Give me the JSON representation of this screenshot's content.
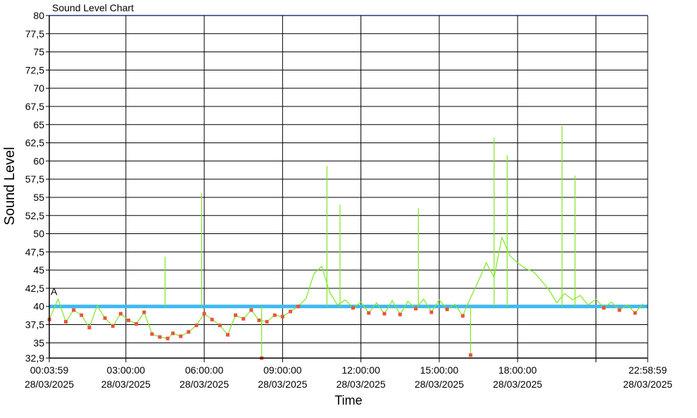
{
  "chart_data": {
    "type": "line",
    "title": "Sound Level Chart",
    "xlabel": "Time",
    "ylabel": "Sound Level",
    "ylim": [
      32.9,
      80
    ],
    "y_ticks": [
      "32,9",
      "35",
      "37,5",
      "40",
      "42,5",
      "45",
      "47,5",
      "50",
      "52,5",
      "55",
      "57,5",
      "60",
      "62,5",
      "65",
      "67,5",
      "70",
      "72,5",
      "75",
      "77,5",
      "80"
    ],
    "x_range_hours": [
      0.0664,
      22.9831
    ],
    "x_ticks": [
      {
        "time": "00:03:59",
        "date": "28/03/2025"
      },
      {
        "time": "03:00:00",
        "date": "28/03/2025"
      },
      {
        "time": "06:00:00",
        "date": "28/03/2025"
      },
      {
        "time": "09:00:00",
        "date": "28/03/2025"
      },
      {
        "time": "12:00:00",
        "date": "28/03/2025"
      },
      {
        "time": "15:00:00",
        "date": "28/03/2025"
      },
      {
        "time": "18:00:00",
        "date": "28/03/2025"
      },
      {
        "time": "",
        "date": ""
      },
      {
        "time": "22:58:59",
        "date": "28/03/2025"
      }
    ],
    "x_tick_hours": [
      0.0664,
      3,
      6,
      9,
      12,
      15,
      18,
      21,
      22.9831
    ],
    "grid": true,
    "threshold": {
      "label": "A",
      "value": 40,
      "color": "#3fb8f0"
    },
    "series": [
      {
        "name": "",
        "color": "#7ee81f",
        "marker_color": "#e8543a",
        "x_hours": [
          0.07,
          0.4,
          0.7,
          1.0,
          1.3,
          1.6,
          1.9,
          2.2,
          2.5,
          2.8,
          3.1,
          3.4,
          3.7,
          4.0,
          4.3,
          4.6,
          4.8,
          5.1,
          5.4,
          5.7,
          6.0,
          6.3,
          6.6,
          6.9,
          7.2,
          7.5,
          7.8,
          8.1,
          8.4,
          8.7,
          9.0,
          9.3,
          9.6,
          9.9,
          10.2,
          10.5,
          10.8,
          11.1,
          11.4,
          11.7,
          12.0,
          12.3,
          12.6,
          12.9,
          13.2,
          13.5,
          13.8,
          14.1,
          14.4,
          14.7,
          15.0,
          15.3,
          15.6,
          15.9,
          16.2,
          16.5,
          16.8,
          17.1,
          17.4,
          17.7,
          18.0,
          18.3,
          18.6,
          18.9,
          19.2,
          19.5,
          19.8,
          20.1,
          20.4,
          20.7,
          21.0,
          21.3,
          21.6,
          21.9,
          22.2,
          22.5,
          22.8
        ],
        "values": [
          38.2,
          41,
          37.9,
          39.5,
          38.8,
          37.1,
          40.1,
          38.4,
          37.3,
          39,
          38.1,
          37.6,
          39.2,
          36.2,
          35.8,
          35.6,
          36.3,
          35.9,
          36.5,
          37.4,
          39,
          38.2,
          37.4,
          36.1,
          38.8,
          38.3,
          39.5,
          38.1,
          37.9,
          38.8,
          38.6,
          39.3,
          40,
          41.1,
          44.5,
          45.5,
          42,
          40.2,
          40.9,
          39.8,
          40.6,
          39.1,
          40.5,
          39,
          40.8,
          38.9,
          40.7,
          39.7,
          41,
          39.2,
          40.9,
          39.6,
          40.3,
          38.7,
          41.2,
          43.5,
          46,
          44,
          49.5,
          47,
          46,
          45.2,
          44.8,
          43.6,
          42.3,
          40.5,
          41.8,
          40.9,
          41.5,
          40.2,
          41,
          39.8,
          40.6,
          39.5,
          40.2,
          39.1,
          40.4
        ]
      }
    ],
    "annotations": [
      {
        "x_hours": 4.5,
        "value": 46.8
      },
      {
        "x_hours": 5.9,
        "value": 55.5
      },
      {
        "x_hours": 8.2,
        "value": 32.9
      },
      {
        "x_hours": 10.7,
        "value": 59.3
      },
      {
        "x_hours": 11.2,
        "value": 54
      },
      {
        "x_hours": 14.2,
        "value": 53.5
      },
      {
        "x_hours": 16.2,
        "value": 33.3
      },
      {
        "x_hours": 17.1,
        "value": 63.2
      },
      {
        "x_hours": 17.6,
        "value": 60.8
      },
      {
        "x_hours": 19.7,
        "value": 64.8
      },
      {
        "x_hours": 20.2,
        "value": 58
      }
    ]
  }
}
